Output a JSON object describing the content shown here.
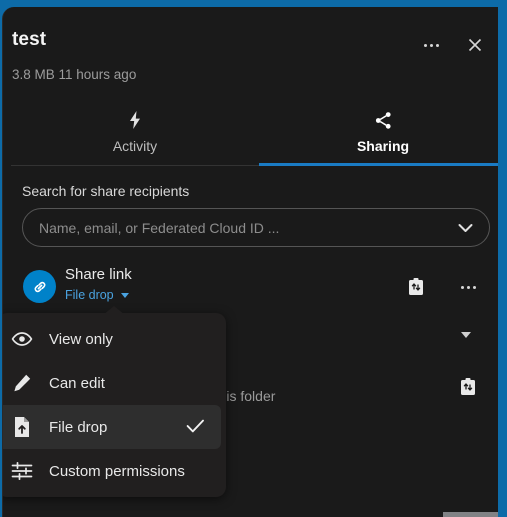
{
  "window": {
    "accent_color": "#0d6ba8",
    "panel_bg": "#1a1a1a"
  },
  "header": {
    "title": "test",
    "subtitle": "3.8 MB 11 hours ago",
    "more_icon": "ellipsis-icon",
    "close_icon": "close-icon"
  },
  "tabs": [
    {
      "id": "activity",
      "label": "Activity",
      "icon": "lightning-bolt-icon",
      "active": false
    },
    {
      "id": "sharing",
      "label": "Sharing",
      "icon": "share-nodes-icon",
      "active": true
    }
  ],
  "search": {
    "label": "Search for share recipients",
    "placeholder": "Name, email, or Federated Cloud ID ...",
    "value": "",
    "chevron_icon": "chevron-down-icon"
  },
  "share_link": {
    "avatar_icon": "link-icon",
    "avatar_color": "#0082c9",
    "name": "Share link",
    "permission": "File drop",
    "permission_color": "#4aa3e0",
    "copy_icon": "copy-clipboard-icon",
    "more_icon": "ellipsis-icon"
  },
  "second_row": {
    "text": "ith access to this folder",
    "chevron_icon": "chevron-down-icon",
    "copy_icon": "copy-clipboard-icon"
  },
  "permission_menu": {
    "items": [
      {
        "label": "View only",
        "icon": "eye-icon",
        "selected": false
      },
      {
        "label": "Can edit",
        "icon": "pencil-icon",
        "selected": false
      },
      {
        "label": "File drop",
        "icon": "file-upload-icon",
        "selected": true
      },
      {
        "label": "Custom permissions",
        "icon": "sliders-icon",
        "selected": false
      }
    ],
    "check_icon": "check-icon"
  }
}
